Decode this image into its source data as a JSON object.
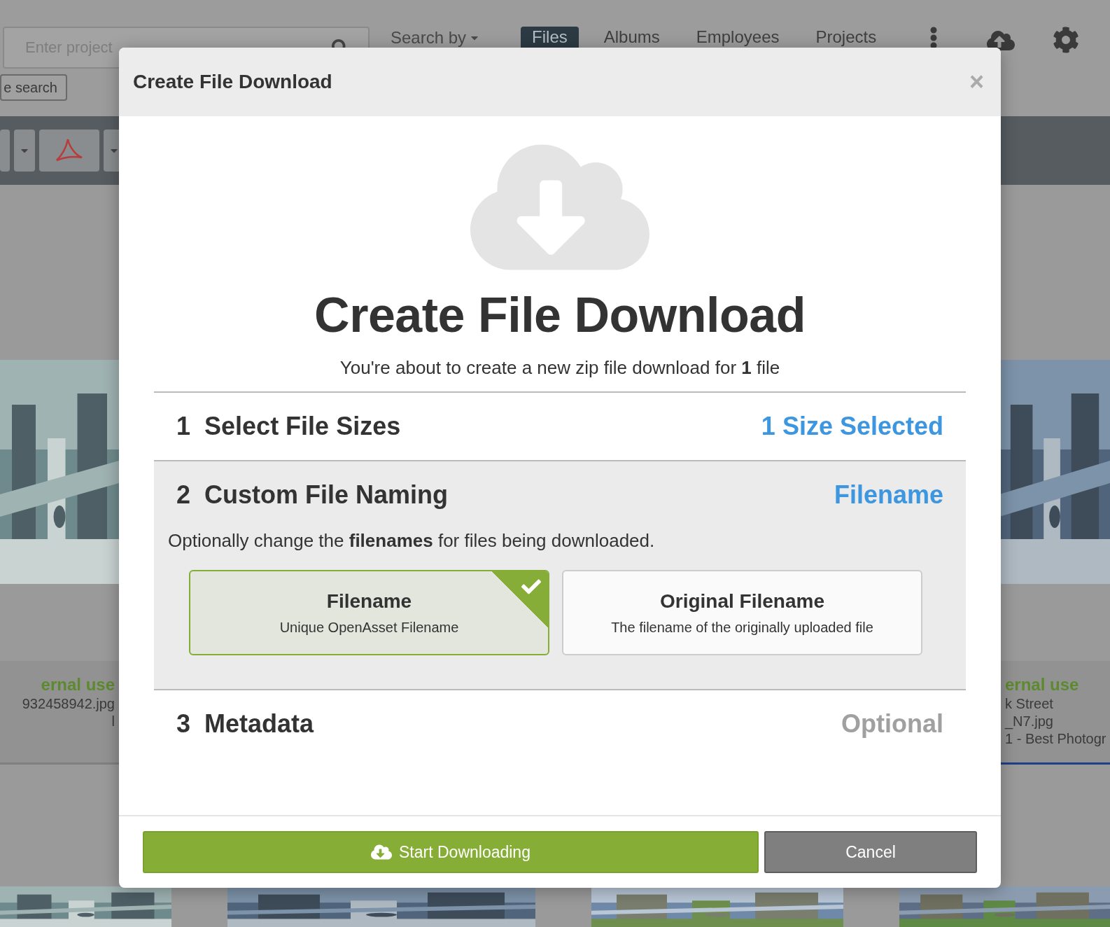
{
  "background": {
    "search_placeholder": "Enter project",
    "search_button": "e search",
    "search_by": "Search by",
    "nav_tabs": [
      {
        "label": "Files",
        "selected": true
      },
      {
        "label": "Albums",
        "selected": false
      },
      {
        "label": "Employees",
        "selected": false
      },
      {
        "label": "Projects",
        "selected": false
      }
    ],
    "cards": [
      {
        "title": "ernal use",
        "lines": [
          "932458942.jpg",
          "l"
        ],
        "selected": false
      },
      {
        "title": "ernal use",
        "lines": [
          "k Street",
          "_N7.jpg",
          "1 - Best Photogr"
        ],
        "selected": true
      }
    ]
  },
  "modal": {
    "header_title": "Create File Download",
    "close": "×",
    "heading": "Create File Download",
    "subtitle": "You're about to create a new zip file download for **1** file",
    "sections": [
      {
        "number": "1",
        "title": "Select File Sizes",
        "status": "1 Size Selected",
        "color": "#3d96e0",
        "expanded": false
      },
      {
        "number": "2",
        "title": "Custom File Naming",
        "status": "Filename",
        "color": "#3d96e0",
        "expanded": true,
        "description": "Optionally change the **filenames** for files being downloaded.",
        "options": [
          {
            "title": "Filename",
            "subtitle": "Unique OpenAsset Filename",
            "selected": true
          },
          {
            "title": "Original Filename",
            "subtitle": "The filename of the originally uploaded file",
            "selected": false
          }
        ]
      },
      {
        "number": "3",
        "title": "Metadata",
        "status": "Optional",
        "color": "#a0a0a0",
        "expanded": false
      }
    ],
    "buttons": [
      {
        "label": "Start Downloading",
        "kind": "primary"
      },
      {
        "label": "Cancel",
        "kind": "secondary"
      }
    ]
  }
}
